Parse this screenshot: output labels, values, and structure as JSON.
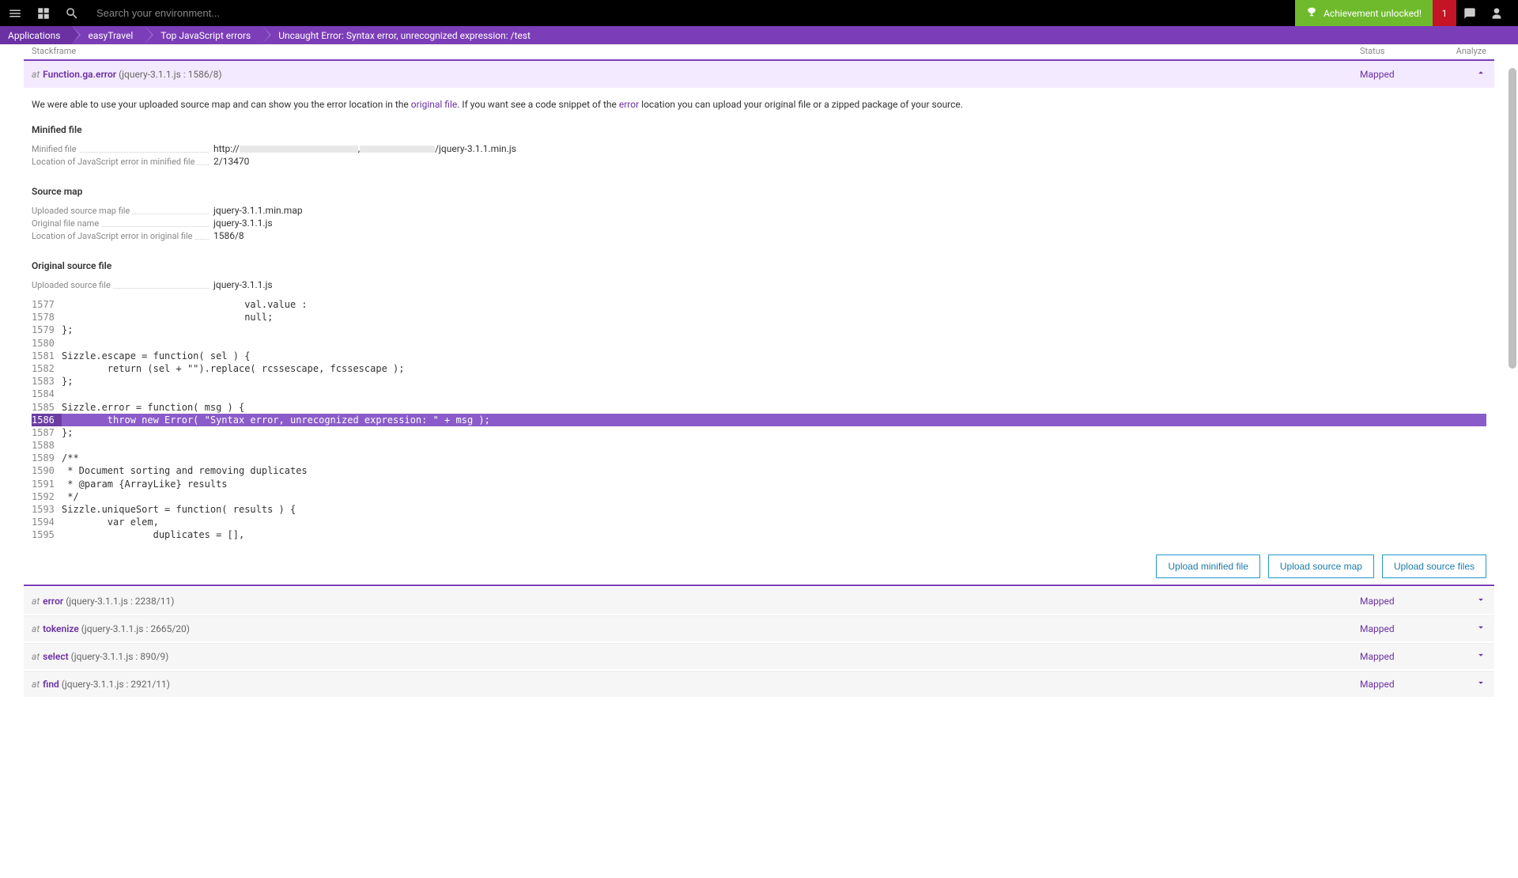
{
  "topbar": {
    "search_placeholder": "Search your environment...",
    "achievement": "Achievement unlocked!",
    "badge_count": "1"
  },
  "breadcrumbs": [
    "Applications",
    "easyTravel",
    "Top JavaScript errors",
    "Uncaught Error: Syntax error, unrecognized expression: /test"
  ],
  "headers": {
    "stackframe": "Stackframe",
    "status": "Status",
    "analyze": "Analyze"
  },
  "expanded_frame": {
    "fn": "Function.ga.error",
    "loc": "(jquery-3.1.1.js : 1586/8)",
    "status": "Mapped"
  },
  "description_parts": {
    "p1": "We were able to use your uploaded source map and can show you the error location in the ",
    "link1": "original file",
    "p2": ". If you want see a code snippet of the ",
    "link2": "error",
    "p3": " location you can upload your original file or a zipped package of your source."
  },
  "minified": {
    "title": "Minified file",
    "rows": [
      {
        "label": "Minified file",
        "prefix": "http://",
        "suffix": "/jquery-3.1.1.min.js",
        "redacted": true
      },
      {
        "label": "Location of JavaScript error in minified file",
        "value": "2/13470"
      }
    ]
  },
  "sourcemap": {
    "title": "Source map",
    "rows": [
      {
        "label": "Uploaded source map file",
        "value": "jquery-3.1.1.min.map"
      },
      {
        "label": "Original file name",
        "value": "jquery-3.1.1.js"
      },
      {
        "label": "Location of JavaScript error in original file",
        "value": "1586/8"
      }
    ]
  },
  "original": {
    "title": "Original source file",
    "rows": [
      {
        "label": "Uploaded source file",
        "value": "jquery-3.1.1.js"
      }
    ]
  },
  "code": [
    {
      "n": "1577",
      "t": "                                val.value :"
    },
    {
      "n": "1578",
      "t": "                                null;"
    },
    {
      "n": "1579",
      "t": "};"
    },
    {
      "n": "1580",
      "t": ""
    },
    {
      "n": "1581",
      "t": "Sizzle.escape = function( sel ) {"
    },
    {
      "n": "1582",
      "t": "        return (sel + \"\").replace( rcssescape, fcssescape );"
    },
    {
      "n": "1583",
      "t": "};"
    },
    {
      "n": "1584",
      "t": ""
    },
    {
      "n": "1585",
      "t": "Sizzle.error = function( msg ) {"
    },
    {
      "n": "1586",
      "t": "        throw new Error( \"Syntax error, unrecognized expression: \" + msg );",
      "hl": true
    },
    {
      "n": "1587",
      "t": "};"
    },
    {
      "n": "1588",
      "t": ""
    },
    {
      "n": "1589",
      "t": "/**"
    },
    {
      "n": "1590",
      "t": " * Document sorting and removing duplicates"
    },
    {
      "n": "1591",
      "t": " * @param {ArrayLike} results"
    },
    {
      "n": "1592",
      "t": " */"
    },
    {
      "n": "1593",
      "t": "Sizzle.uniqueSort = function( results ) {"
    },
    {
      "n": "1594",
      "t": "        var elem,"
    },
    {
      "n": "1595",
      "t": "                duplicates = [],"
    }
  ],
  "buttons": {
    "upload_minified": "Upload minified file",
    "upload_map": "Upload source map",
    "upload_source": "Upload source files"
  },
  "frames": [
    {
      "fn": "error",
      "loc": "(jquery-3.1.1.js : 2238/11)",
      "status": "Mapped"
    },
    {
      "fn": "tokenize",
      "loc": "(jquery-3.1.1.js : 2665/20)",
      "status": "Mapped"
    },
    {
      "fn": "select",
      "loc": "(jquery-3.1.1.js : 890/9)",
      "status": "Mapped"
    },
    {
      "fn": "find",
      "loc": "(jquery-3.1.1.js : 2921/11)",
      "status": "Mapped"
    }
  ]
}
